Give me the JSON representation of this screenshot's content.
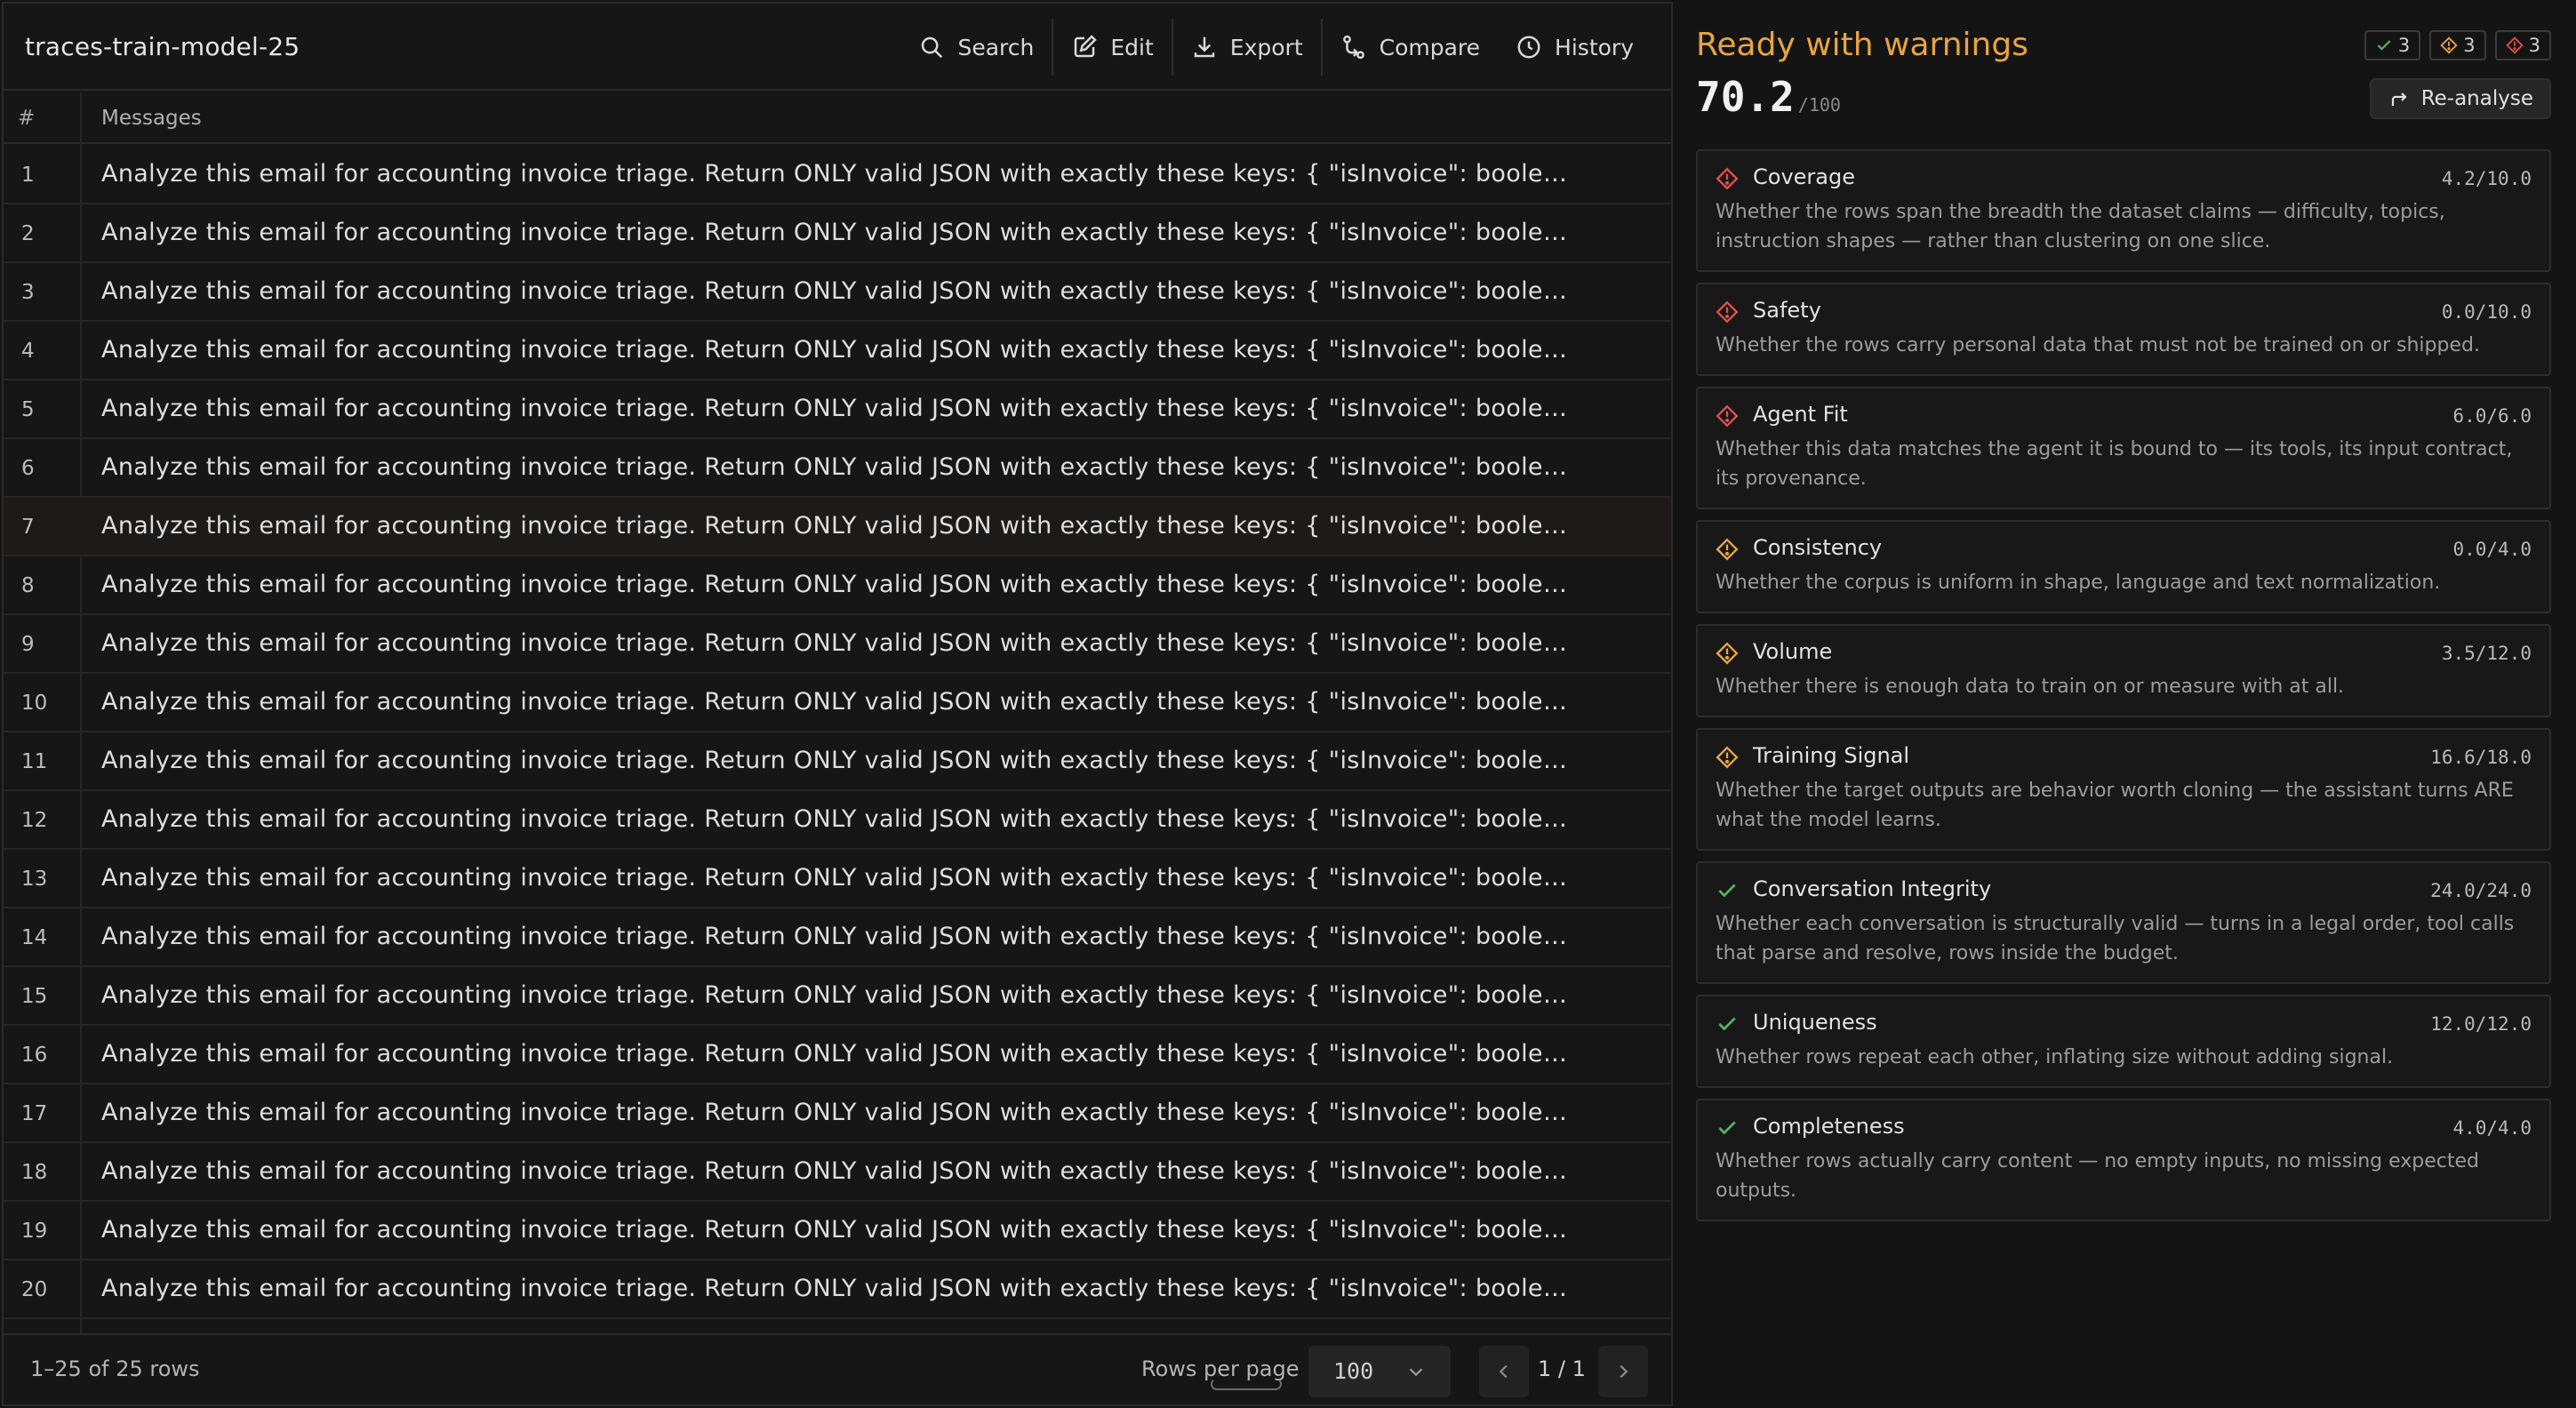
{
  "dataset": {
    "title": "traces-train-model-25"
  },
  "toolbar": {
    "search": "Search",
    "edit": "Edit",
    "export": "Export",
    "compare": "Compare",
    "history": "History"
  },
  "table": {
    "col_num": "#",
    "col_messages": "Messages",
    "rows": [
      {
        "n": "1",
        "m": "Analyze this email for accounting invoice triage. Return ONLY valid JSON with exactly these keys: { \"isInvoice\": boolean,..."
      },
      {
        "n": "2",
        "m": "Analyze this email for accounting invoice triage. Return ONLY valid JSON with exactly these keys: { \"isInvoice\": boolean,..."
      },
      {
        "n": "3",
        "m": "Analyze this email for accounting invoice triage. Return ONLY valid JSON with exactly these keys: { \"isInvoice\": boolean,..."
      },
      {
        "n": "4",
        "m": "Analyze this email for accounting invoice triage. Return ONLY valid JSON with exactly these keys: { \"isInvoice\": boolean,..."
      },
      {
        "n": "5",
        "m": "Analyze this email for accounting invoice triage. Return ONLY valid JSON with exactly these keys: { \"isInvoice\": boolean,..."
      },
      {
        "n": "6",
        "m": "Analyze this email for accounting invoice triage. Return ONLY valid JSON with exactly these keys: { \"isInvoice\": boolean,..."
      },
      {
        "n": "7",
        "m": "Analyze this email for accounting invoice triage. Return ONLY valid JSON with exactly these keys: { \"isInvoice\": boolean,..."
      },
      {
        "n": "8",
        "m": "Analyze this email for accounting invoice triage. Return ONLY valid JSON with exactly these keys: { \"isInvoice\": boolean,..."
      },
      {
        "n": "9",
        "m": "Analyze this email for accounting invoice triage. Return ONLY valid JSON with exactly these keys: { \"isInvoice\": boolean,..."
      },
      {
        "n": "10",
        "m": "Analyze this email for accounting invoice triage. Return ONLY valid JSON with exactly these keys: { \"isInvoice\": boolean,..."
      },
      {
        "n": "11",
        "m": "Analyze this email for accounting invoice triage. Return ONLY valid JSON with exactly these keys: { \"isInvoice\": boolean,..."
      },
      {
        "n": "12",
        "m": "Analyze this email for accounting invoice triage. Return ONLY valid JSON with exactly these keys: { \"isInvoice\": boolean,..."
      },
      {
        "n": "13",
        "m": "Analyze this email for accounting invoice triage. Return ONLY valid JSON with exactly these keys: { \"isInvoice\": boolean,..."
      },
      {
        "n": "14",
        "m": "Analyze this email for accounting invoice triage. Return ONLY valid JSON with exactly these keys: { \"isInvoice\": boolean,..."
      },
      {
        "n": "15",
        "m": "Analyze this email for accounting invoice triage. Return ONLY valid JSON with exactly these keys: { \"isInvoice\": boolean,..."
      },
      {
        "n": "16",
        "m": "Analyze this email for accounting invoice triage. Return ONLY valid JSON with exactly these keys: { \"isInvoice\": boolean,..."
      },
      {
        "n": "17",
        "m": "Analyze this email for accounting invoice triage. Return ONLY valid JSON with exactly these keys: { \"isInvoice\": boolean,..."
      },
      {
        "n": "18",
        "m": "Analyze this email for accounting invoice triage. Return ONLY valid JSON with exactly these keys: { \"isInvoice\": boolean,..."
      },
      {
        "n": "19",
        "m": "Analyze this email for accounting invoice triage. Return ONLY valid JSON with exactly these keys: { \"isInvoice\": boolean,..."
      },
      {
        "n": "20",
        "m": "Analyze this email for accounting invoice triage. Return ONLY valid JSON with exactly these keys: { \"isInvoice\": boolean,..."
      }
    ]
  },
  "footer": {
    "count": "1–25 of 25 rows",
    "rows_per_page_label": "Rows per page",
    "rows_per_page_value": "100",
    "page": "1 / 1"
  },
  "report": {
    "title": "Ready with warnings",
    "score": "70.2",
    "score_max": "/100",
    "reanalyse": "Re-analyse",
    "badge_pass": "3",
    "badge_warn": "3",
    "badge_fail": "3",
    "colors": {
      "warning": "#e6a443",
      "fail": "#e0504a",
      "pass": "#57b36a"
    },
    "checks": [
      {
        "status": "fail",
        "name": "Coverage",
        "score": "4.2/10.0",
        "desc": "Whether the rows span the breadth the dataset claims — difficulty, topics, instruction shapes — rather than clustering on one slice."
      },
      {
        "status": "fail",
        "name": "Safety",
        "score": "0.0/10.0",
        "desc": "Whether the rows carry personal data that must not be trained on or shipped."
      },
      {
        "status": "fail",
        "name": "Agent Fit",
        "score": "6.0/6.0",
        "desc": "Whether this data matches the agent it is bound to — its tools, its input contract, its provenance."
      },
      {
        "status": "warn",
        "name": "Consistency",
        "score": "0.0/4.0",
        "desc": "Whether the corpus is uniform in shape, language and text normalization."
      },
      {
        "status": "warn",
        "name": "Volume",
        "score": "3.5/12.0",
        "desc": "Whether there is enough data to train on or measure with at all."
      },
      {
        "status": "warn",
        "name": "Training Signal",
        "score": "16.6/18.0",
        "desc": "Whether the target outputs are behavior worth cloning — the assistant turns ARE what the model learns."
      },
      {
        "status": "pass",
        "name": "Conversation Integrity",
        "score": "24.0/24.0",
        "desc": "Whether each conversation is structurally valid — turns in a legal order, tool calls that parse and resolve, rows inside the budget."
      },
      {
        "status": "pass",
        "name": "Uniqueness",
        "score": "12.0/12.0",
        "desc": "Whether rows repeat each other, inflating size without adding signal."
      },
      {
        "status": "pass",
        "name": "Completeness",
        "score": "4.0/4.0",
        "desc": "Whether rows actually carry content — no empty inputs, no missing expected outputs."
      }
    ]
  }
}
